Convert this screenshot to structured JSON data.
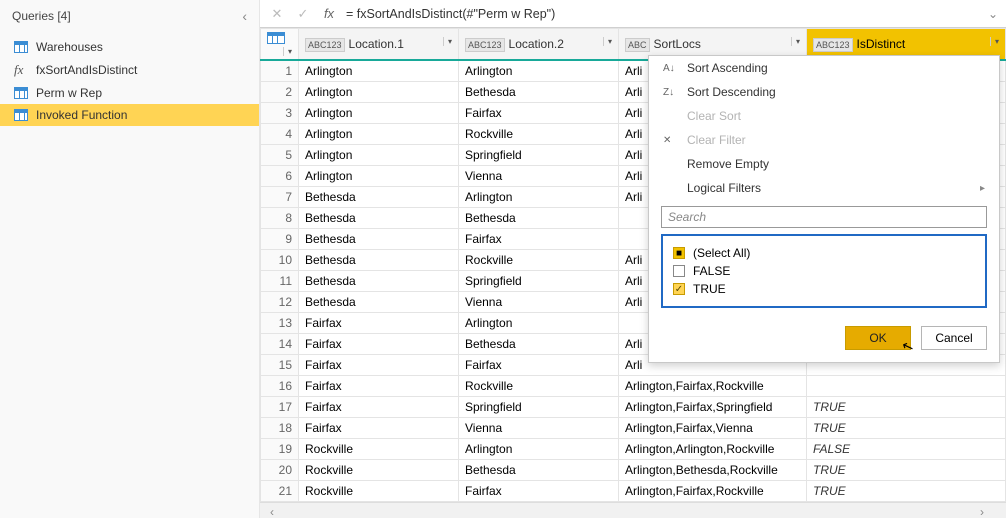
{
  "queries_panel": {
    "title": "Queries [4]",
    "items": [
      {
        "label": "Warehouses",
        "icon": "table",
        "selected": false
      },
      {
        "label": "fxSortAndIsDistinct",
        "icon": "fx",
        "selected": false
      },
      {
        "label": "Perm w Rep",
        "icon": "table",
        "selected": false
      },
      {
        "label": "Invoked Function",
        "icon": "table",
        "selected": true
      }
    ]
  },
  "formula_bar": {
    "label_fx": "fx",
    "value": "= fxSortAndIsDistinct(#\"Perm w Rep\")"
  },
  "columns": {
    "loc1": {
      "label": "Location.1",
      "type": "ABC123"
    },
    "loc2": {
      "label": "Location.2",
      "type": "ABC123"
    },
    "sortlocs": {
      "label": "SortLocs",
      "type": "ABC"
    },
    "isdistinct": {
      "label": "IsDistinct",
      "type": "ABC123"
    }
  },
  "rows": [
    {
      "n": "1",
      "a": "Arlington",
      "b": "Arlington",
      "c": "Arli",
      "d": ""
    },
    {
      "n": "2",
      "a": "Arlington",
      "b": "Bethesda",
      "c": "Arli",
      "d": ""
    },
    {
      "n": "3",
      "a": "Arlington",
      "b": "Fairfax",
      "c": "Arli",
      "d": ""
    },
    {
      "n": "4",
      "a": "Arlington",
      "b": "Rockville",
      "c": "Arli",
      "d": ""
    },
    {
      "n": "5",
      "a": "Arlington",
      "b": "Springfield",
      "c": "Arli",
      "d": ""
    },
    {
      "n": "6",
      "a": "Arlington",
      "b": "Vienna",
      "c": "Arli",
      "d": ""
    },
    {
      "n": "7",
      "a": "Bethesda",
      "b": "Arlington",
      "c": "Arli",
      "d": ""
    },
    {
      "n": "8",
      "a": "Bethesda",
      "b": "Bethesda",
      "c": "",
      "d": ""
    },
    {
      "n": "9",
      "a": "Bethesda",
      "b": "Fairfax",
      "c": "",
      "d": ""
    },
    {
      "n": "10",
      "a": "Bethesda",
      "b": "Rockville",
      "c": "Arli",
      "d": ""
    },
    {
      "n": "11",
      "a": "Bethesda",
      "b": "Springfield",
      "c": "Arli",
      "d": ""
    },
    {
      "n": "12",
      "a": "Bethesda",
      "b": "Vienna",
      "c": "Arli",
      "d": ""
    },
    {
      "n": "13",
      "a": "Fairfax",
      "b": "Arlington",
      "c": "",
      "d": ""
    },
    {
      "n": "14",
      "a": "Fairfax",
      "b": "Bethesda",
      "c": "Arli",
      "d": ""
    },
    {
      "n": "15",
      "a": "Fairfax",
      "b": "Fairfax",
      "c": "Arli",
      "d": ""
    },
    {
      "n": "16",
      "a": "Fairfax",
      "b": "Rockville",
      "c": "Arlington,Fairfax,Rockville",
      "d": ""
    },
    {
      "n": "17",
      "a": "Fairfax",
      "b": "Springfield",
      "c": "Arlington,Fairfax,Springfield",
      "d": "TRUE"
    },
    {
      "n": "18",
      "a": "Fairfax",
      "b": "Vienna",
      "c": "Arlington,Fairfax,Vienna",
      "d": "TRUE"
    },
    {
      "n": "19",
      "a": "Rockville",
      "b": "Arlington",
      "c": "Arlington,Arlington,Rockville",
      "d": "FALSE"
    },
    {
      "n": "20",
      "a": "Rockville",
      "b": "Bethesda",
      "c": "Arlington,Bethesda,Rockville",
      "d": "TRUE"
    },
    {
      "n": "21",
      "a": "Rockville",
      "b": "Fairfax",
      "c": "Arlington,Fairfax,Rockville",
      "d": "TRUE"
    }
  ],
  "filter_dropdown": {
    "sort_asc": "Sort Ascending",
    "sort_desc": "Sort Descending",
    "clear_sort": "Clear Sort",
    "clear_filter": "Clear Filter",
    "remove_empty": "Remove Empty",
    "logical_filters": "Logical Filters",
    "search_placeholder": "Search",
    "options": [
      {
        "label": "(Select All)",
        "state": "mixed"
      },
      {
        "label": "FALSE",
        "state": "unchecked"
      },
      {
        "label": "TRUE",
        "state": "checked"
      }
    ],
    "ok": "OK",
    "cancel": "Cancel"
  }
}
